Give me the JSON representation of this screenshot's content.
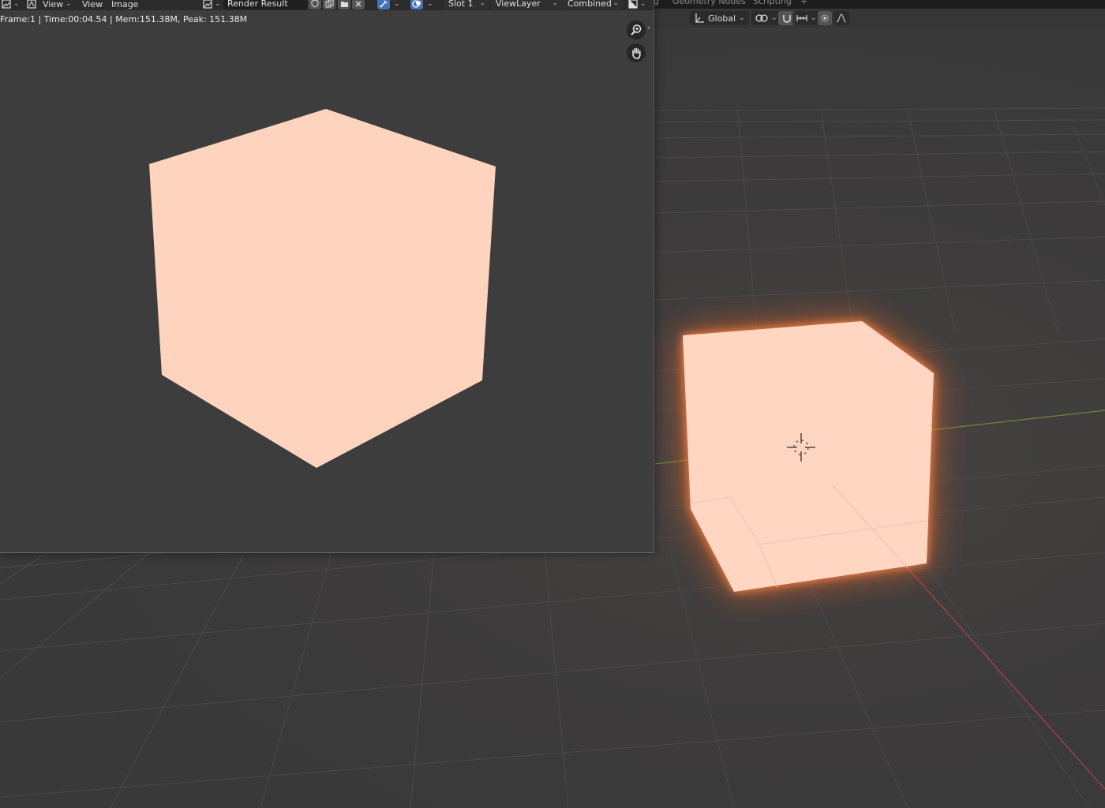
{
  "workspace_tabs": {
    "items": [
      {
        "label": "g"
      },
      {
        "label": "Geometry Nodes"
      },
      {
        "label": "Scripting"
      },
      {
        "label": "+"
      }
    ]
  },
  "viewport_header": {
    "transform_orientation": "Global"
  },
  "image_editor": {
    "header": {
      "view_menu_1": "View",
      "view_menu_2": "View",
      "image_menu": "Image",
      "image_name": "Render Result",
      "slot": "Slot 1",
      "view_layer": "ViewLayer",
      "pass": "Combined"
    },
    "stats": "Frame:1 | Time:00:04.54 | Mem:151.38M, Peak: 151.38M"
  },
  "colors": {
    "cube_face": "#ffd4be",
    "glow": "#ff6a24",
    "editor_bg": "#3d3d3d",
    "header_bg": "#2b2b2b",
    "accent_blue": "#4772b3",
    "axis_red": "#b3414a",
    "axis_green": "#6a8a3a"
  },
  "icons": {
    "zoom": "zoom-icon",
    "pan": "hand-pan-icon",
    "cursor": "3d-cursor-icon"
  }
}
